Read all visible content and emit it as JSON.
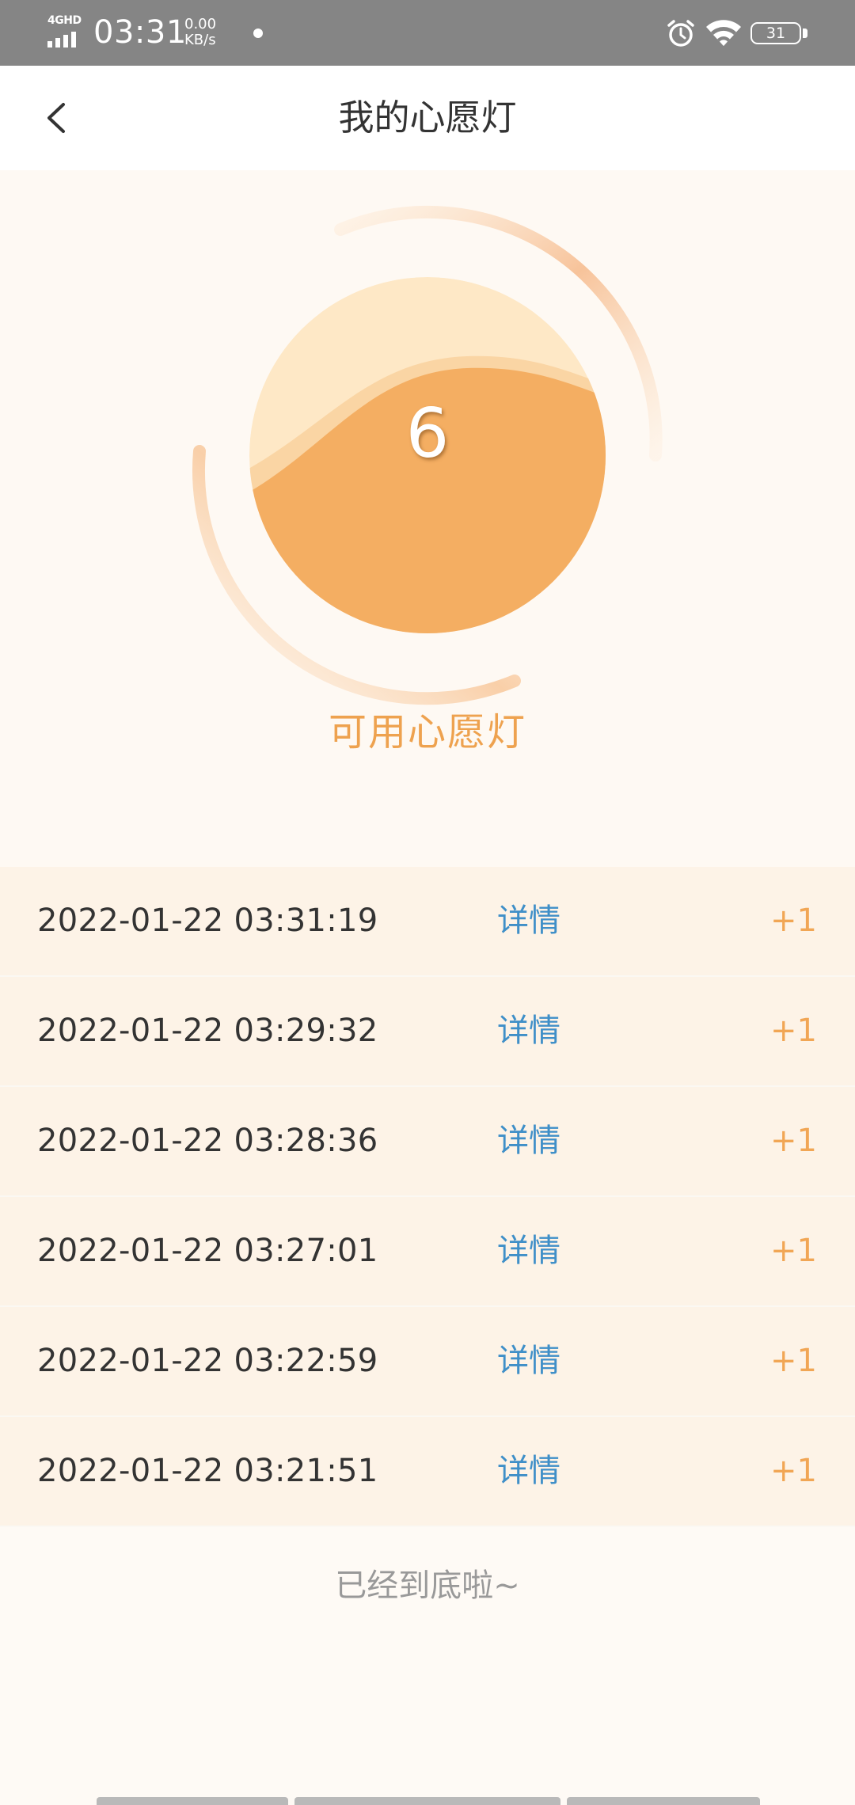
{
  "status_bar": {
    "network": "4GHD",
    "time": "03:31",
    "speed_value": "0.00",
    "speed_unit": "KB/s",
    "battery": "31",
    "icons": [
      "signal-icon",
      "alarm-icon",
      "wifi-icon",
      "battery-icon"
    ]
  },
  "header": {
    "title": "我的心愿灯",
    "back_icon": "chevron-left-icon"
  },
  "lamp": {
    "count": "6",
    "label": "可用心愿灯",
    "colors": {
      "fill": "#f4ae62",
      "highlight": "#fee8c6",
      "ring": "#f7caa0",
      "label": "#eea24f"
    }
  },
  "records": [
    {
      "time": "2022-01-22 03:31:19",
      "detail": "详情",
      "count": "+1"
    },
    {
      "time": "2022-01-22 03:29:32",
      "detail": "详情",
      "count": "+1"
    },
    {
      "time": "2022-01-22 03:28:36",
      "detail": "详情",
      "count": "+1"
    },
    {
      "time": "2022-01-22 03:27:01",
      "detail": "详情",
      "count": "+1"
    },
    {
      "time": "2022-01-22 03:22:59",
      "detail": "详情",
      "count": "+1"
    },
    {
      "time": "2022-01-22 03:21:51",
      "detail": "详情",
      "count": "+1"
    }
  ],
  "footer_note": "已经到底啦~"
}
